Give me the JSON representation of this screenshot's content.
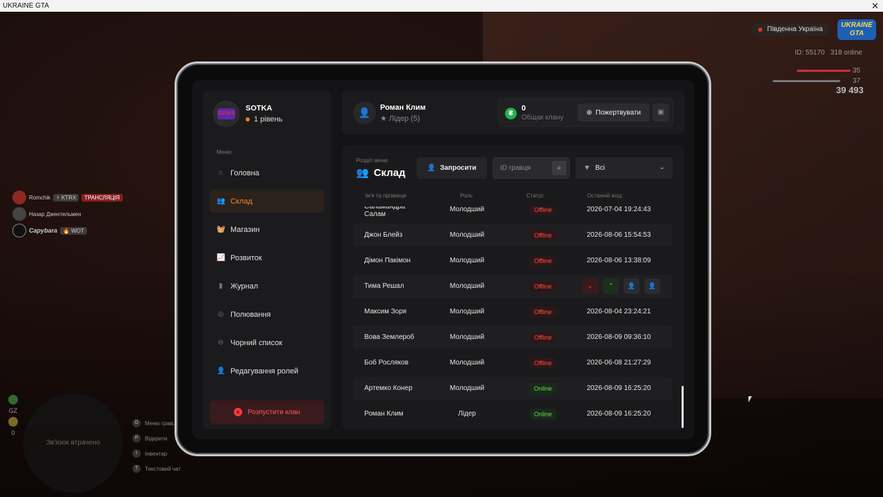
{
  "window": {
    "title": "UKRAINE GTA",
    "close": "✕"
  },
  "hud": {
    "region": "Південна Україна",
    "logo": "UKRAINE GTA",
    "id_text": "ID: 55170",
    "online_text": "318 online",
    "health": "35",
    "armor": "37",
    "money": "39 493",
    "players": [
      {
        "name": "Romchik",
        "badges": [
          "⚡ KTRX",
          "ТРАНСЛЯЦІЯ"
        ]
      },
      {
        "name": "Назар Джентельмен",
        "badges": []
      },
      {
        "name": "Capybara",
        "badges": [
          "🔥 WOT"
        ]
      }
    ],
    "radar_text": "Зв'язок втрачено",
    "side": [
      "GZ",
      "0"
    ],
    "hints": [
      {
        "key": "O",
        "label": "Меню гравця"
      },
      {
        "key": "P",
        "label": "Відкрити"
      },
      {
        "key": "I",
        "label": "Інвентар"
      },
      {
        "key": "T",
        "label": "Текстовий чат"
      }
    ]
  },
  "clan": {
    "name": "SOTKA",
    "level": "1 рівень",
    "avatar_text": "SOTKA"
  },
  "menu": {
    "label": "Меню",
    "items": [
      {
        "label": "Головна",
        "icon": "home-icon",
        "glyph": "⌂"
      },
      {
        "label": "Склад",
        "icon": "people-icon",
        "glyph": "👥"
      },
      {
        "label": "Магазин",
        "icon": "basket-icon",
        "glyph": "🧺"
      },
      {
        "label": "Розвиток",
        "icon": "chart-icon",
        "glyph": "📈"
      },
      {
        "label": "Журнал",
        "icon": "book-icon",
        "glyph": "▮"
      },
      {
        "label": "Полювання",
        "icon": "hunt-icon",
        "glyph": "◎"
      },
      {
        "label": "Чорний список",
        "icon": "block-icon",
        "glyph": "⊖"
      },
      {
        "label": "Редагування ролей",
        "icon": "user-edit-icon",
        "glyph": "👤"
      }
    ],
    "active_index": 1,
    "disband": "Розпустити клан"
  },
  "user": {
    "name": "Роман Клим",
    "role": "Лідер (5)"
  },
  "fund": {
    "value": "0",
    "label": "Общак клану",
    "donate": "Пожертвувати"
  },
  "section": {
    "caption": "Розділ меню",
    "title": "Склад",
    "invite": "Запросити",
    "search_placeholder": "ID гравця",
    "filter": "Всі"
  },
  "table": {
    "headers": [
      "Ім'я та прізвище",
      "Роль",
      "Статус",
      "Останній вхід"
    ],
    "rows": [
      {
        "name": "Саламандра Салам",
        "role": "Молодший",
        "status": "Offline",
        "last": "2026-07-04 19:24:43"
      },
      {
        "name": "Джон Блейз",
        "role": "Молодший",
        "status": "Offline",
        "last": "2026-08-06 15:54:53"
      },
      {
        "name": "Дімон Пакімон",
        "role": "Молодший",
        "status": "Offline",
        "last": "2026-08-06 13:38:09"
      },
      {
        "name": "Тима Решал",
        "role": "Молодший",
        "status": "Offline",
        "last": ""
      },
      {
        "name": "Максим Зоря",
        "role": "Молодший",
        "status": "Offline",
        "last": "2026-08-04 23:24:21"
      },
      {
        "name": "Вова Землероб",
        "role": "Молодший",
        "status": "Offline",
        "last": "2026-08-09 09:36:10"
      },
      {
        "name": "Боб Росляков",
        "role": "Молодший",
        "status": "Offline",
        "last": "2026-06-08 21:27:29"
      },
      {
        "name": "Артемко Конер",
        "role": "Молодший",
        "status": "Online",
        "last": "2026-08-09 16:25:20"
      },
      {
        "name": "Роман Клим",
        "role": "Лідер",
        "status": "Online",
        "last": "2026-08-09 16:25:20"
      }
    ],
    "hover_row_index": 3,
    "row_actions": [
      "demote",
      "promote",
      "kick",
      "add"
    ]
  }
}
